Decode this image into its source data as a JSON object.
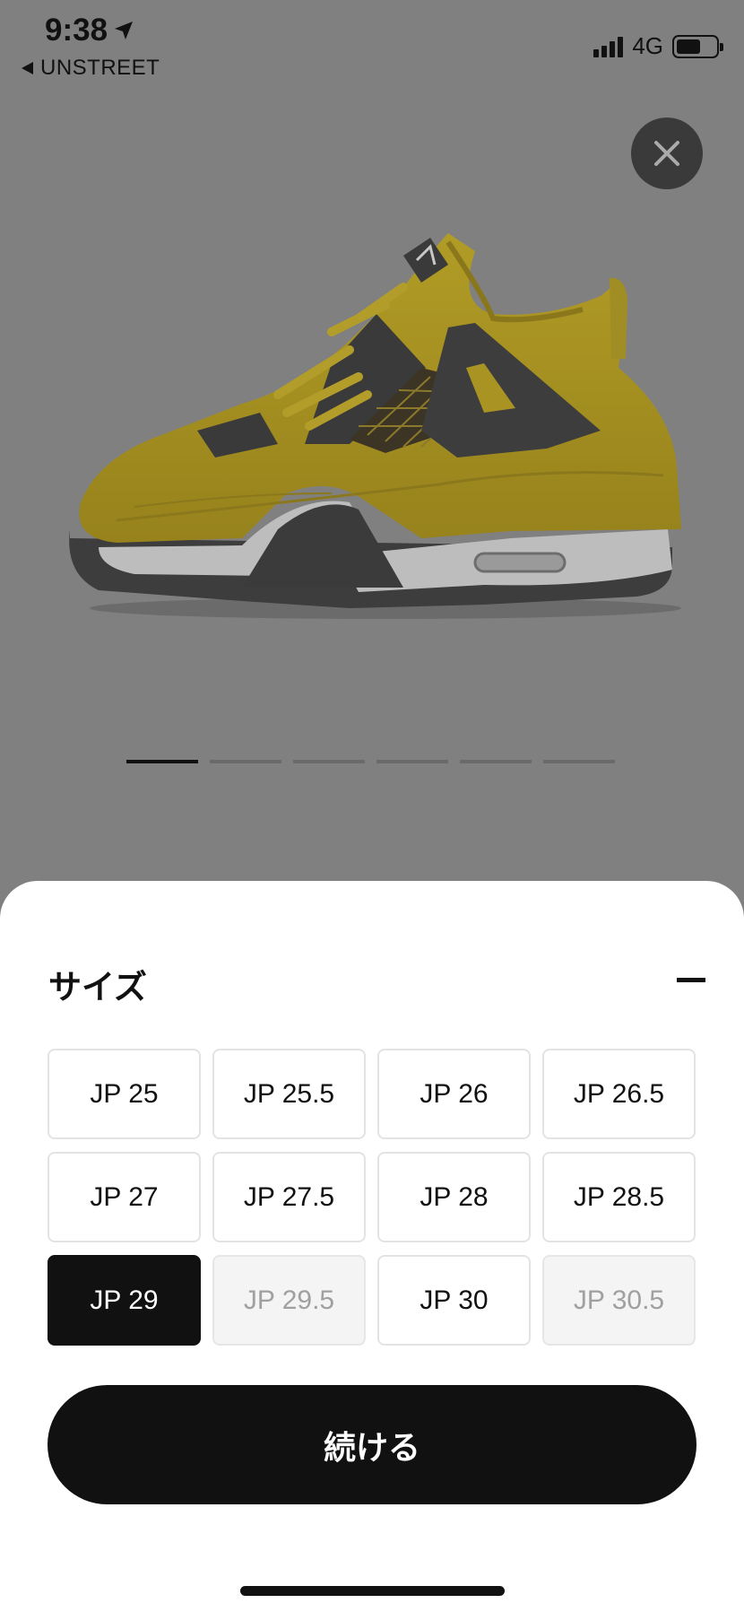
{
  "status_bar": {
    "time": "9:38",
    "back_app": "UNSTREET",
    "network": "4G",
    "battery_level": 0.62
  },
  "carousel": {
    "count": 6,
    "active_index": 0
  },
  "size_sheet": {
    "title": "サイズ",
    "sizes": [
      {
        "label": "JP 25",
        "state": "available"
      },
      {
        "label": "JP 25.5",
        "state": "available"
      },
      {
        "label": "JP 26",
        "state": "available"
      },
      {
        "label": "JP 26.5",
        "state": "available"
      },
      {
        "label": "JP 27",
        "state": "available"
      },
      {
        "label": "JP 27.5",
        "state": "available"
      },
      {
        "label": "JP 28",
        "state": "available"
      },
      {
        "label": "JP 28.5",
        "state": "available"
      },
      {
        "label": "JP 29",
        "state": "selected"
      },
      {
        "label": "JP 29.5",
        "state": "unavailable"
      },
      {
        "label": "JP 30",
        "state": "available"
      },
      {
        "label": "JP 30.5",
        "state": "unavailable"
      }
    ],
    "continue_label": "続ける"
  },
  "colors": {
    "overlay": "#808080",
    "shoe_upper": "#a89323",
    "accent_black": "#111111"
  }
}
